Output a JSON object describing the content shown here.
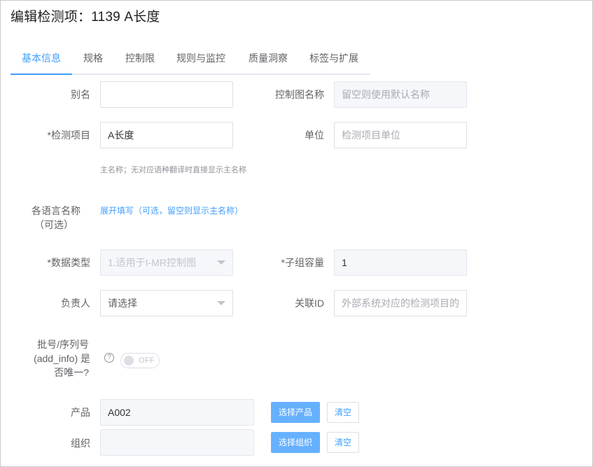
{
  "page": {
    "title": "编辑检测项：1139 A长度"
  },
  "tabs": [
    {
      "label": "基本信息",
      "active": true
    },
    {
      "label": "规格"
    },
    {
      "label": "控制限"
    },
    {
      "label": "规则与监控"
    },
    {
      "label": "质量洞察"
    },
    {
      "label": "标签与扩展"
    }
  ],
  "form": {
    "alias": {
      "label": "别名",
      "value": ""
    },
    "chart_name": {
      "label": "控制图名称",
      "placeholder": "留空则使用默认名称"
    },
    "item": {
      "label": "*检测项目",
      "value": "A长度",
      "hint": "主名称；无对应语种翻译时直接显示主名称"
    },
    "unit": {
      "label": "单位",
      "placeholder": "检测项目单位"
    },
    "lang_names": {
      "label_line1": "各语言名称",
      "label_line2": "（可选）",
      "link": "展开填写（可选，留空则显示主名称）"
    },
    "data_type": {
      "label": "*数据类型",
      "value": "1.适用于I-MR控制图"
    },
    "subgroup": {
      "label": "*子组容量",
      "value": "1"
    },
    "owner": {
      "label": "负责人",
      "value": "请选择"
    },
    "related_id": {
      "label": "关联ID",
      "placeholder": "外部系统对应的检测项目的ID"
    },
    "batch_unique": {
      "label_line1": "批号/序列号",
      "label_line2": "(add_info) 是",
      "label_line3": "否唯一?",
      "help": "?",
      "switch_text": "OFF"
    },
    "product": {
      "label": "产品",
      "value": "A002",
      "select_button": "选择产品",
      "clear_button": "清空"
    },
    "org": {
      "label": "组织",
      "value": "",
      "select_button": "选择组织",
      "clear_button": "清空"
    }
  }
}
